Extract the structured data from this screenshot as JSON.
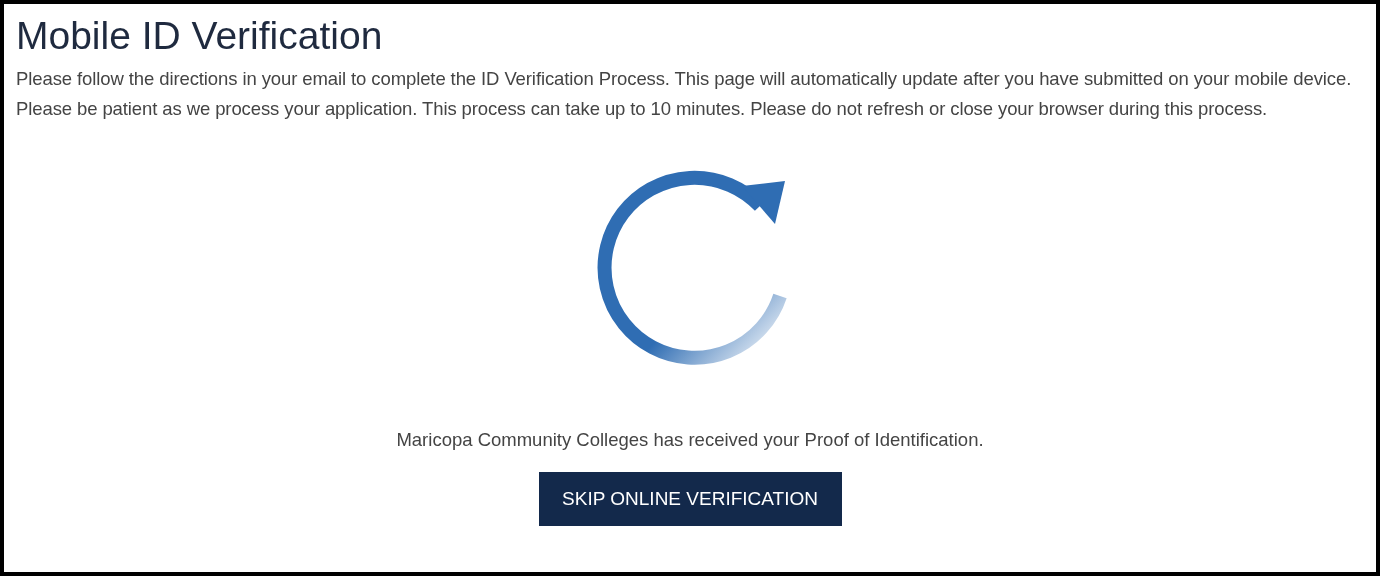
{
  "page": {
    "title": "Mobile ID Verification",
    "instructions": "Please follow the directions in your email to complete the ID Verification Process. This page will automatically update after you have submitted on your mobile device. Please be patient as we process your application. This process can take up to 10 minutes. Please do not refresh or close your browser during this process.",
    "status_message": "Maricopa Community Colleges has received your Proof of Identification.",
    "skip_button": "SKIP ONLINE VERIFICATION"
  }
}
